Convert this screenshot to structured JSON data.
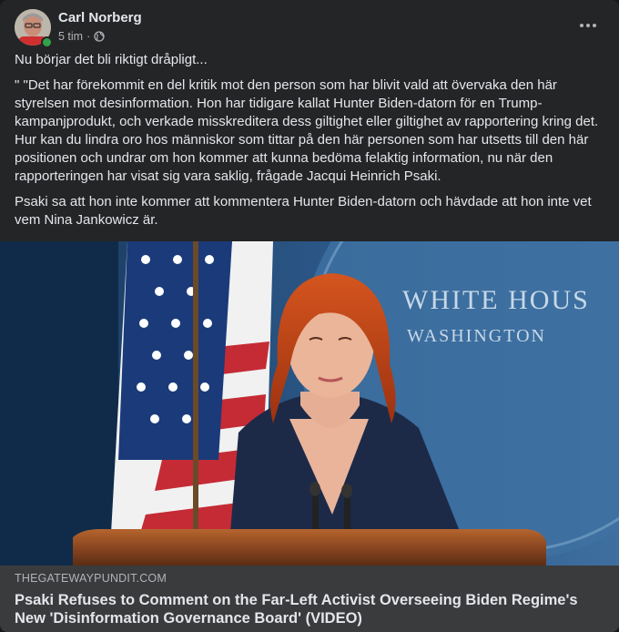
{
  "post": {
    "author": "Carl Norberg",
    "time": "5 tim",
    "separator": "·",
    "privacy_icon": "globe-icon",
    "more_icon": "more-horizontal-icon",
    "paragraphs": [
      "Nu börjar det bli riktigt dråpligt...",
      "\" \"Det har förekommit en del kritik mot den person som har blivit vald att övervaka den här styrelsen mot desinformation. Hon har tidigare kallat Hunter Biden-datorn för en Trump-kampanjprodukt, och verkade misskreditera dess giltighet eller giltighet av rapportering kring det. Hur kan du lindra oro hos människor som tittar på den här personen som har utsetts till den här positionen och undrar om hon kommer att kunna bedöma felaktig information, nu när den rapporteringen har visat sig vara saklig, frågade Jacqui Heinrich Psaki.",
      "Psaki sa att hon inte kommer att kommentera Hunter Biden-datorn och hävdade att hon inte vet vem Nina Jankowicz är."
    ]
  },
  "image": {
    "sign_line1": "WHITE HOUS",
    "sign_line2": "WASHINGTON"
  },
  "link": {
    "domain": "THEGATEWAYPUNDIT.COM",
    "title": "Psaki Refuses to Comment on the Far-Left Activist Overseeing Biden Regime's New 'Disinformation Governance Board' (VIDEO)"
  },
  "colors": {
    "card_bg": "#242526",
    "link_bg": "#3a3b3c",
    "online": "#31a24c"
  }
}
